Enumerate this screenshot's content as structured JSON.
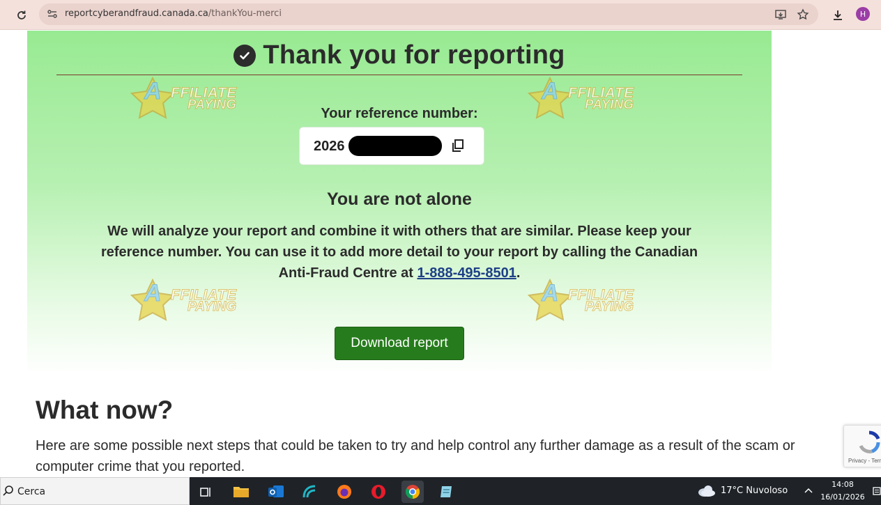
{
  "browser": {
    "url_host": "reportcyberandfraud.canada.ca",
    "url_path": "/thankYou-merci",
    "profile_initial": "H"
  },
  "page": {
    "title": "Thank you for reporting",
    "reference_label": "Your reference number:",
    "reference_value": "2026",
    "section_heading": "You are not alone",
    "body_text": "We will analyze your report and combine it with others that are similar. Please keep your reference number. You can use it to add more detail to your report by calling the Canadian Anti-Fraud Centre at ",
    "phone": "1-888-495-8501",
    "body_suffix": ".",
    "download_label": "Download report",
    "what_now_heading": "What now?",
    "next_steps_text": "Here are some possible next steps that could be taken to try and help control any further damage as a result of the scam or computer crime that you reported.",
    "recaptcha_text": "Privacy - Terms"
  },
  "watermark": {
    "line1": "FFILIATE",
    "line2": "PAYING",
    "letter": "A"
  },
  "taskbar": {
    "search_placeholder": "Cerca",
    "weather": "17°C  Nuvoloso",
    "time": "14:08",
    "date": "16/01/2026"
  },
  "colors": {
    "panel_green": "#98ea92",
    "button_green": "#267c1c",
    "link_blue": "#1d3f86"
  }
}
